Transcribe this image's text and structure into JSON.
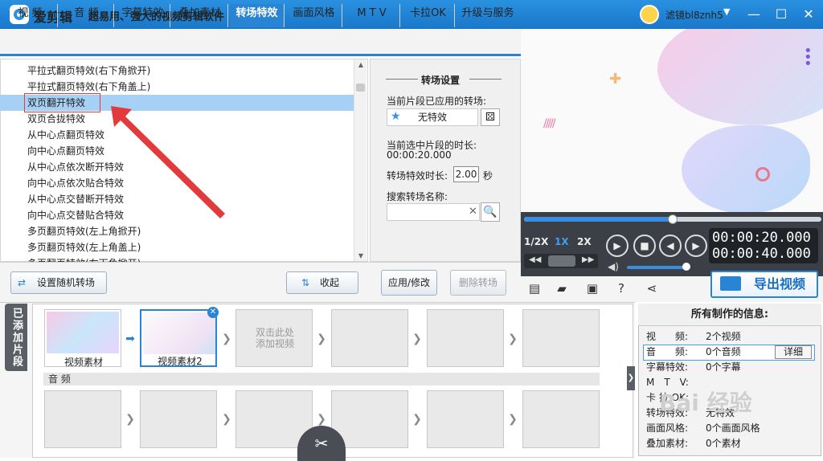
{
  "app": {
    "name": "爱剪辑",
    "slogan": "超易用、强大的视频剪辑软件",
    "username": "滤镜bl8znh5",
    "user_dropdown": "▼",
    "window_minimize": "—",
    "window_maximize": "☐",
    "window_close": "✕"
  },
  "tabs": [
    "视 频",
    "音 频",
    "字幕特效",
    "叠加素材",
    "转场特效",
    "画面风格",
    "M T V",
    "卡拉OK",
    "升级与服务"
  ],
  "active_tab": "转场特效",
  "transitions": [
    "平拉式翻页特效(右下角掀开)",
    "平拉式翻页特效(右下角盖上)",
    "双页翻开特效",
    "双页合拢特效",
    "从中心点翻页特效",
    "向中心点翻页特效",
    "从中心点依次断开特效",
    "向中心点依次贴合特效",
    "从中心点交替断开特效",
    "向中心点交替贴合特效",
    "多页翻页特效(左上角掀开)",
    "多页翻页特效(左上角盖上)",
    "多页翻页特效(右下角掀开)"
  ],
  "selected_transition": "双页翻开特效",
  "settings": {
    "title": "转场设置",
    "applied_label": "当前片段已应用的转场:",
    "applied_value": "无特效",
    "duration_label": "当前选中片段的时长:",
    "duration_value": "00:00:20.000",
    "effect_duration_label": "转场特效时长:",
    "effect_duration_value": "2.00",
    "effect_duration_unit": "秒",
    "search_label": "搜索转场名称:",
    "search_value": "",
    "apply_button": "应用/修改",
    "delete_button": "删除转场"
  },
  "left_controls": {
    "random_button": "设置随机转场",
    "up_button": "收起"
  },
  "player": {
    "speed_half": "1/2X",
    "speed_1x": "1X",
    "speed_2x": "2X",
    "current_time": "00:00:20.000",
    "total_time": "00:00:40.000",
    "progress_fraction": 0.5,
    "volume_fraction": 0.95
  },
  "export_button": "导出视频",
  "timeline": {
    "side_tab": "已添加片段",
    "clips": [
      "视频素材",
      "视频素材2"
    ],
    "add_hint": "双击此处添加视频",
    "audio_label": "音 频"
  },
  "info": {
    "title": "所有制作的信息:",
    "rows": [
      {
        "k": "视　　频:",
        "v": "2个视频"
      },
      {
        "k": "音　　频:",
        "v": "0个音频"
      },
      {
        "k": "字幕特效:",
        "v": "0个字幕"
      },
      {
        "k": "M　T　V:",
        "v": ""
      },
      {
        "k": "卡 拉 OK:",
        "v": ""
      },
      {
        "k": "转场特效:",
        "v": "无特效"
      },
      {
        "k": "画面风格:",
        "v": "0个画面风格"
      },
      {
        "k": "叠加素材:",
        "v": "0个素材"
      }
    ],
    "detail_button": "详细"
  },
  "watermark": "Bai 经验",
  "colors": {
    "accent": "#2a84d4",
    "selection": "#a7d1f4",
    "annotation": "#e23b3b"
  }
}
